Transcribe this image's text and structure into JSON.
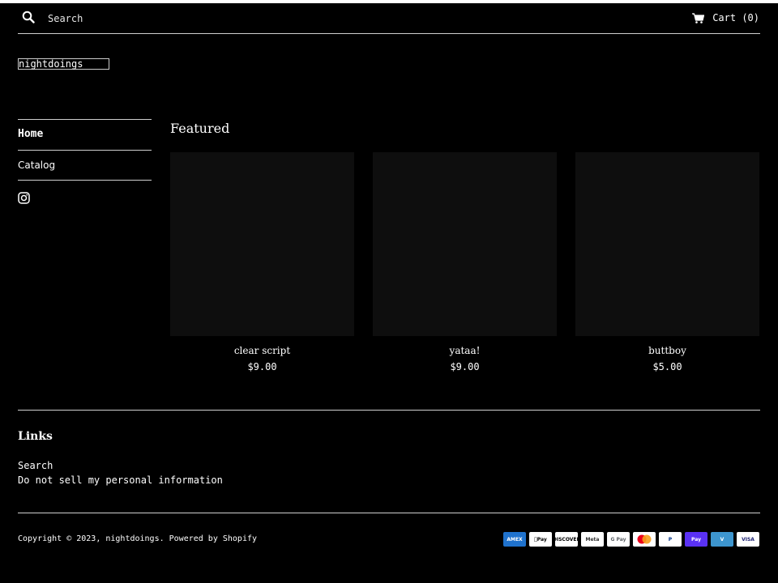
{
  "header": {
    "search_placeholder": "Search",
    "cart_label": "Cart (0)"
  },
  "store": {
    "name": "nightdoings"
  },
  "sidebar": {
    "items": [
      {
        "label": "Home"
      },
      {
        "label": "Catalog"
      }
    ]
  },
  "featured": {
    "title": "Featured",
    "products": [
      {
        "name": "clear script",
        "price": "$9.00"
      },
      {
        "name": "yataa!",
        "price": "$9.00"
      },
      {
        "name": "buttboy",
        "price": "$5.00"
      }
    ]
  },
  "footer": {
    "links_title": "Links",
    "links": [
      {
        "label": "Search"
      },
      {
        "label": "Do not sell my personal information"
      }
    ],
    "copyright": "Copyright © 2023, nightdoings. Powered by Shopify",
    "payments": [
      {
        "name": "amex-icon",
        "label": "AMEX",
        "bg": "#1f72cd",
        "fg": "#ffffff"
      },
      {
        "name": "apple-pay-icon",
        "label": "Pay",
        "bg": "#ffffff",
        "fg": "#000000"
      },
      {
        "name": "discover-icon",
        "label": "DISCOVER",
        "bg": "#ffffff",
        "fg": "#000000"
      },
      {
        "name": "meta-pay-icon",
        "label": "Meta",
        "bg": "#ffffff",
        "fg": "#333333"
      },
      {
        "name": "google-pay-icon",
        "label": "G Pay",
        "bg": "#ffffff",
        "fg": "#5f6368"
      },
      {
        "name": "mastercard-icon",
        "label": "",
        "bg": "#ffffff",
        "fg": "#000000"
      },
      {
        "name": "paypal-icon",
        "label": "P",
        "bg": "#ffffff",
        "fg": "#003087"
      },
      {
        "name": "shop-pay-icon",
        "label": "Pay",
        "bg": "#5a31f4",
        "fg": "#ffffff"
      },
      {
        "name": "venmo-icon",
        "label": "V",
        "bg": "#3d95ce",
        "fg": "#ffffff"
      },
      {
        "name": "visa-icon",
        "label": "VISA",
        "bg": "#ffffff",
        "fg": "#1a1f71"
      }
    ]
  }
}
